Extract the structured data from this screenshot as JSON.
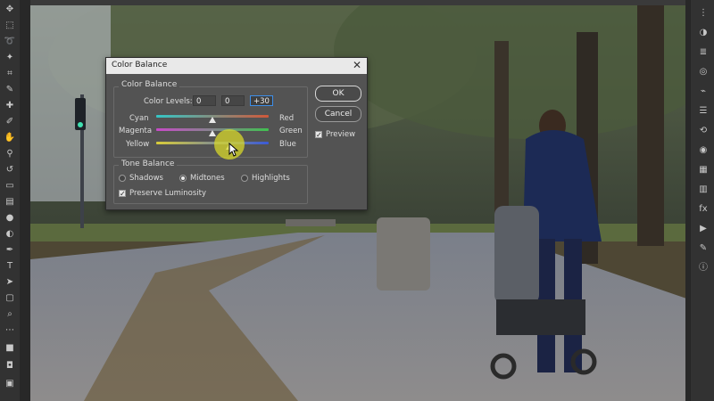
{
  "dialog": {
    "title": "Color Balance",
    "close_icon": "close-icon",
    "color_balance_group": "Color Balance",
    "color_levels_label": "Color Levels:",
    "levels": [
      "0",
      "0",
      "+30"
    ],
    "sliders": [
      {
        "left": "Cyan",
        "right": "Red",
        "value": 0
      },
      {
        "left": "Magenta",
        "right": "Green",
        "value": 0
      },
      {
        "left": "Yellow",
        "right": "Blue",
        "value": 30
      }
    ],
    "tone_balance_group": "Tone Balance",
    "tones": [
      "Shadows",
      "Midtones",
      "Highlights"
    ],
    "selected_tone": "Midtones",
    "preserve_luminosity": "Preserve Luminosity",
    "preserve_checked": true,
    "ok_label": "OK",
    "cancel_label": "Cancel",
    "preview_label": "Preview",
    "preview_checked": true
  },
  "toolbar": {
    "icons": [
      "move-icon",
      "marquee-icon",
      "lasso-icon",
      "magic-wand-icon",
      "crop-icon",
      "eyedropper-icon",
      "healing-icon",
      "brush-icon",
      "stamp-icon",
      "history-brush-icon",
      "eraser-icon",
      "gradient-icon",
      "blur-icon",
      "dodge-icon",
      "pen-icon",
      "type-icon",
      "path-select-icon",
      "shape-icon",
      "hand-icon",
      "zoom-icon",
      "more-tools-icon",
      "foreground-color-icon",
      "quick-mask-icon",
      "screen-mode-icon"
    ]
  },
  "right_panel": {
    "icons": [
      "panel-icon",
      "adjustments-icon",
      "layers-icon",
      "channels-icon",
      "paths-icon",
      "properties-icon",
      "history-icon",
      "color-icon",
      "swatches-icon",
      "libraries-icon",
      "styles-icon",
      "actions-icon",
      "brushes-icon",
      "info-icon"
    ]
  },
  "colors": {
    "accent": "#3d8ee8",
    "halo": "#dcdc28"
  }
}
